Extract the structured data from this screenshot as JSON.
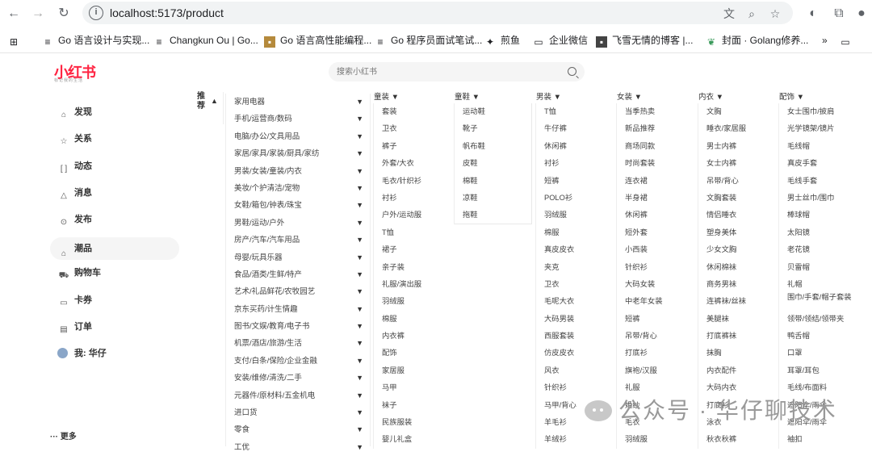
{
  "browser": {
    "url": "localhost:5173/product",
    "bookmarks": [
      {
        "label": "Go 语言设计与实现...",
        "icon": "doc-icon"
      },
      {
        "label": "Changkun Ou | Go...",
        "icon": "doc-icon"
      },
      {
        "label": "Go 语言高性能编程...",
        "icon": "image-icon"
      },
      {
        "label": "Go 程序员面试笔试...",
        "icon": "doc-icon"
      },
      {
        "label": "煎鱼",
        "icon": "fish-icon"
      },
      {
        "label": "企业微信",
        "icon": "folder-icon"
      },
      {
        "label": "飞雪无情的博客 |...",
        "icon": "avatar-icon"
      },
      {
        "label": "封面 · Golang修养...",
        "icon": "leaf-icon"
      }
    ]
  },
  "brand": {
    "logo": "小红书",
    "tagline": "标记我的生活",
    "color": "#ff2442"
  },
  "search": {
    "placeholder": "搜索小红书"
  },
  "sidebar": {
    "items": [
      {
        "label": "发现",
        "icon": "home-icon"
      },
      {
        "label": "关系",
        "icon": "star-icon"
      },
      {
        "label": "动态",
        "icon": "bracket-icon"
      },
      {
        "label": "消息",
        "icon": "bell-icon"
      },
      {
        "label": "发布",
        "icon": "plus-circle-icon"
      },
      {
        "label": "潮品",
        "icon": "bag-icon"
      },
      {
        "label": "购物车",
        "icon": "cart-icon"
      },
      {
        "label": "卡券",
        "icon": "card-icon"
      },
      {
        "label": "订单",
        "icon": "order-icon"
      },
      {
        "label": "我: 华仔",
        "icon": "avatar-icon"
      }
    ],
    "active": "潮品",
    "more": "更多"
  },
  "recommend": {
    "title": "推荐",
    "arrow": "▲"
  },
  "categories": [
    "家用电器",
    "手机/运营商/数码",
    "电脑/办公/文具用品",
    "家居/家具/家装/厨具/家纺",
    "男装/女装/童装/内衣",
    "美妆/个护清洁/宠物",
    "女鞋/箱包/钟表/珠宝",
    "男鞋/运动/户外",
    "房产/汽车/汽车用品",
    "母婴/玩具乐器",
    "食品/酒类/生鲜/特产",
    "艺术/礼品鲜花/农牧园艺",
    "京东买药/计生情趣",
    "图书/文娱/教育/电子书",
    "机票/酒店/旅游/生活",
    "支付/白条/保险/企业金融",
    "安装/维修/清洗/二手",
    "元器件/原材料/五金机电",
    "进口货",
    "零食",
    "工优"
  ],
  "columns": [
    {
      "title": "童装 ▼",
      "items": [
        "套装",
        "卫衣",
        "裤子",
        "外套/大衣",
        "毛衣/针织衫",
        "衬衫",
        "户外/运动服",
        "T恤",
        "裙子",
        "亲子装",
        "礼服/演出服",
        "羽绒服",
        "棉服",
        "内衣裤",
        "配饰",
        "家居服",
        "马甲",
        "袜子",
        "民族服装",
        "婴儿礼盒"
      ]
    },
    {
      "title": "童鞋 ▼",
      "items": [
        "运动鞋",
        "靴子",
        "帆布鞋",
        "皮鞋",
        "棉鞋",
        "凉鞋",
        "拖鞋"
      ]
    },
    {
      "title": "男装 ▼",
      "items": [
        "T恤",
        "牛仔裤",
        "休闲裤",
        "衬衫",
        "短裤",
        "POLO衫",
        "羽绒服",
        "棉服",
        "真皮皮衣",
        "夹克",
        "卫衣",
        "毛呢大衣",
        "大码男装",
        "西服套装",
        "仿皮皮衣",
        "风衣",
        "针织衫",
        "马甲/背心",
        "羊毛衫",
        "羊绒衫"
      ]
    },
    {
      "title": "女装 ▼",
      "items": [
        "当季热卖",
        "新品推荐",
        "商场同款",
        "时尚套装",
        "连衣裙",
        "半身裙",
        "休闲裤",
        "短外套",
        "小西装",
        "针织衫",
        "大码女装",
        "中老年女装",
        "短裤",
        "吊带/背心",
        "打底衫",
        "旗袍/汉服",
        "礼服",
        "婚纱",
        "毛衣",
        "羽绒服"
      ]
    },
    {
      "title": "内衣 ▼",
      "items": [
        "文胸",
        "睡衣/家居服",
        "男士内裤",
        "女士内裤",
        "吊带/背心",
        "文胸套装",
        "情侣睡衣",
        "塑身美体",
        "少女文胸",
        "休闲棉袜",
        "商务男袜",
        "连裤袜/丝袜",
        "美腿袜",
        "打底裤袜",
        "抹胸",
        "内衣配件",
        "大码内衣",
        "打底衫",
        "泳衣",
        "秋衣秋裤"
      ]
    },
    {
      "title": "配饰 ▼",
      "items": [
        "女士围巾/披肩",
        "光学镜架/镜片",
        "毛线帽",
        "真皮手套",
        "毛线手套",
        "男士丝巾/围巾",
        "棒球帽",
        "太阳镜",
        "老花镜",
        "贝雷帽",
        "礼帽",
        "围巾/手套/帽子套装",
        "领带/领结/领带夹",
        "鸭舌帽",
        "口罩",
        "耳罩/耳包",
        "毛线/布面料",
        "遮阳伞/雨伞",
        "遮阳伞/雨伞",
        "袖扣"
      ]
    }
  ],
  "watermark": "公众号 · 华仔聊技术"
}
